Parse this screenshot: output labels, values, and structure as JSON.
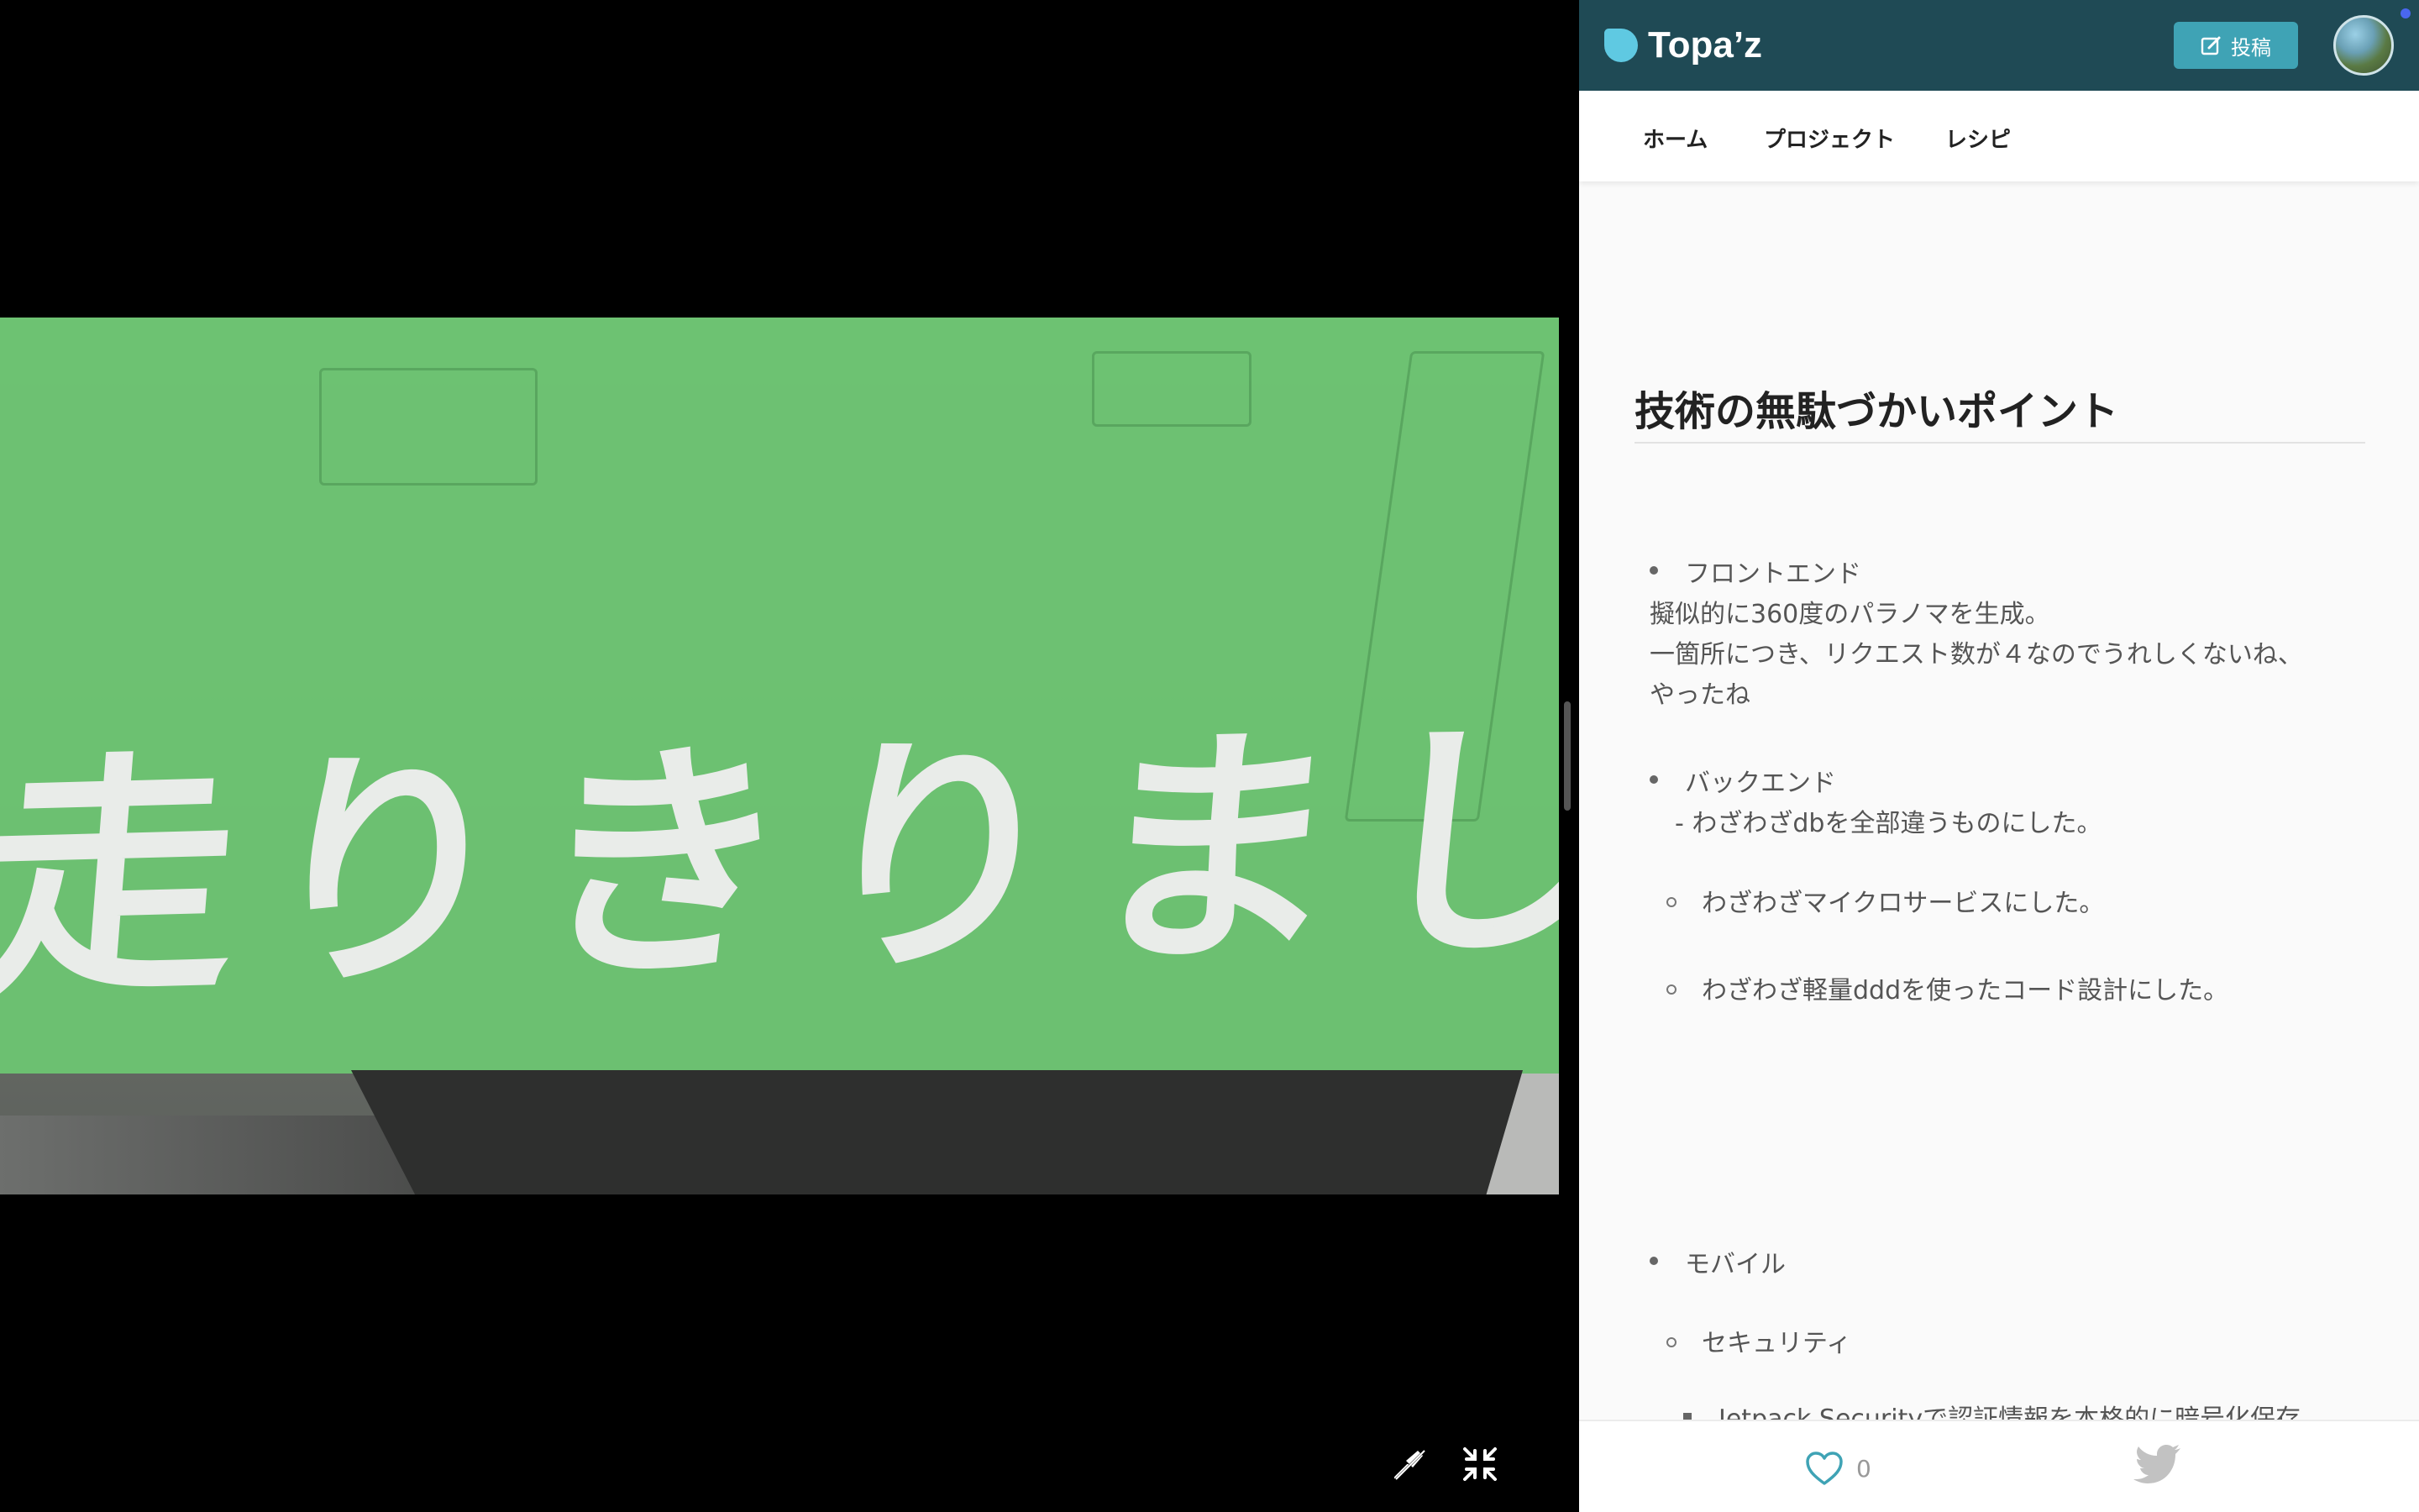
{
  "video": {
    "banner_text": "走りきりました"
  },
  "header": {
    "logo_text": "Topa’z",
    "post_label": "投稿"
  },
  "nav": {
    "items": [
      {
        "label": "ホーム"
      },
      {
        "label": "プロジェクト"
      },
      {
        "label": "レシピ"
      }
    ]
  },
  "article": {
    "title": "技術の無駄づかいポイント",
    "frontend": {
      "heading": "フロントエンド",
      "lines": [
        "擬似的に360度のパラノマを生成。",
        "一箇所につき、リクエスト数が４なのでうれしくないね、",
        "やったね"
      ]
    },
    "backend": {
      "heading": "バックエンド",
      "line": "- わざわざdbを全部違うものにした。",
      "subitems": [
        "わざわざマイクロサービスにした。",
        "わざわざ軽量dddを使ったコード設計にした。"
      ]
    },
    "mobile": {
      "heading": "モバイル",
      "subitem": "セキュリティ",
      "subsub": "Jetpack Securityで認証情報を本格的に暗号化保存"
    }
  },
  "footer": {
    "like_count": "0"
  },
  "colors": {
    "header_bg": "#1f4a55",
    "accent": "#3fa3b5",
    "banner_green": "#6cc471"
  }
}
